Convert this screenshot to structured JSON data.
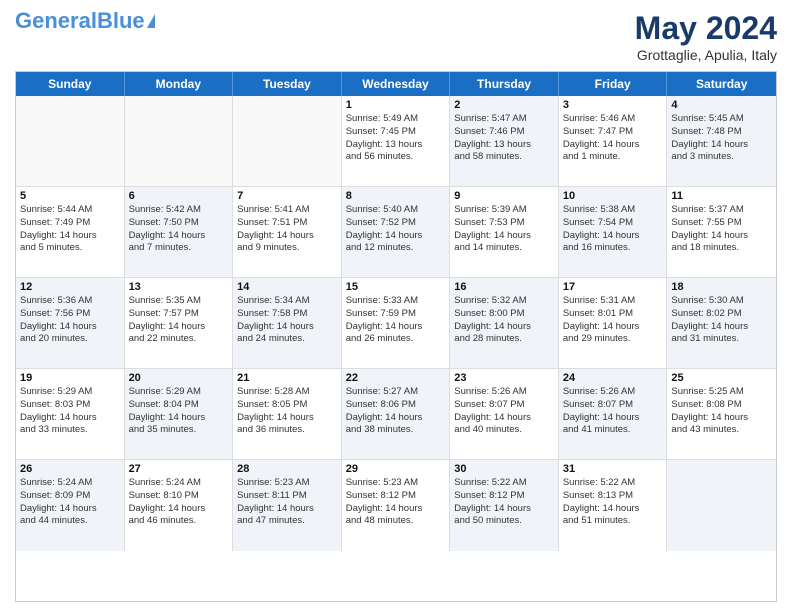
{
  "header": {
    "logo_general": "General",
    "logo_blue": "Blue",
    "month_title": "May 2024",
    "location": "Grottaglie, Apulia, Italy"
  },
  "weekdays": [
    "Sunday",
    "Monday",
    "Tuesday",
    "Wednesday",
    "Thursday",
    "Friday",
    "Saturday"
  ],
  "rows": [
    [
      {
        "day": "",
        "lines": [],
        "shaded": false
      },
      {
        "day": "",
        "lines": [],
        "shaded": false
      },
      {
        "day": "",
        "lines": [],
        "shaded": false
      },
      {
        "day": "1",
        "lines": [
          "Sunrise: 5:49 AM",
          "Sunset: 7:45 PM",
          "Daylight: 13 hours",
          "and 56 minutes."
        ],
        "shaded": false
      },
      {
        "day": "2",
        "lines": [
          "Sunrise: 5:47 AM",
          "Sunset: 7:46 PM",
          "Daylight: 13 hours",
          "and 58 minutes."
        ],
        "shaded": true
      },
      {
        "day": "3",
        "lines": [
          "Sunrise: 5:46 AM",
          "Sunset: 7:47 PM",
          "Daylight: 14 hours",
          "and 1 minute."
        ],
        "shaded": false
      },
      {
        "day": "4",
        "lines": [
          "Sunrise: 5:45 AM",
          "Sunset: 7:48 PM",
          "Daylight: 14 hours",
          "and 3 minutes."
        ],
        "shaded": true
      }
    ],
    [
      {
        "day": "5",
        "lines": [
          "Sunrise: 5:44 AM",
          "Sunset: 7:49 PM",
          "Daylight: 14 hours",
          "and 5 minutes."
        ],
        "shaded": false
      },
      {
        "day": "6",
        "lines": [
          "Sunrise: 5:42 AM",
          "Sunset: 7:50 PM",
          "Daylight: 14 hours",
          "and 7 minutes."
        ],
        "shaded": true
      },
      {
        "day": "7",
        "lines": [
          "Sunrise: 5:41 AM",
          "Sunset: 7:51 PM",
          "Daylight: 14 hours",
          "and 9 minutes."
        ],
        "shaded": false
      },
      {
        "day": "8",
        "lines": [
          "Sunrise: 5:40 AM",
          "Sunset: 7:52 PM",
          "Daylight: 14 hours",
          "and 12 minutes."
        ],
        "shaded": true
      },
      {
        "day": "9",
        "lines": [
          "Sunrise: 5:39 AM",
          "Sunset: 7:53 PM",
          "Daylight: 14 hours",
          "and 14 minutes."
        ],
        "shaded": false
      },
      {
        "day": "10",
        "lines": [
          "Sunrise: 5:38 AM",
          "Sunset: 7:54 PM",
          "Daylight: 14 hours",
          "and 16 minutes."
        ],
        "shaded": true
      },
      {
        "day": "11",
        "lines": [
          "Sunrise: 5:37 AM",
          "Sunset: 7:55 PM",
          "Daylight: 14 hours",
          "and 18 minutes."
        ],
        "shaded": false
      }
    ],
    [
      {
        "day": "12",
        "lines": [
          "Sunrise: 5:36 AM",
          "Sunset: 7:56 PM",
          "Daylight: 14 hours",
          "and 20 minutes."
        ],
        "shaded": true
      },
      {
        "day": "13",
        "lines": [
          "Sunrise: 5:35 AM",
          "Sunset: 7:57 PM",
          "Daylight: 14 hours",
          "and 22 minutes."
        ],
        "shaded": false
      },
      {
        "day": "14",
        "lines": [
          "Sunrise: 5:34 AM",
          "Sunset: 7:58 PM",
          "Daylight: 14 hours",
          "and 24 minutes."
        ],
        "shaded": true
      },
      {
        "day": "15",
        "lines": [
          "Sunrise: 5:33 AM",
          "Sunset: 7:59 PM",
          "Daylight: 14 hours",
          "and 26 minutes."
        ],
        "shaded": false
      },
      {
        "day": "16",
        "lines": [
          "Sunrise: 5:32 AM",
          "Sunset: 8:00 PM",
          "Daylight: 14 hours",
          "and 28 minutes."
        ],
        "shaded": true
      },
      {
        "day": "17",
        "lines": [
          "Sunrise: 5:31 AM",
          "Sunset: 8:01 PM",
          "Daylight: 14 hours",
          "and 29 minutes."
        ],
        "shaded": false
      },
      {
        "day": "18",
        "lines": [
          "Sunrise: 5:30 AM",
          "Sunset: 8:02 PM",
          "Daylight: 14 hours",
          "and 31 minutes."
        ],
        "shaded": true
      }
    ],
    [
      {
        "day": "19",
        "lines": [
          "Sunrise: 5:29 AM",
          "Sunset: 8:03 PM",
          "Daylight: 14 hours",
          "and 33 minutes."
        ],
        "shaded": false
      },
      {
        "day": "20",
        "lines": [
          "Sunrise: 5:29 AM",
          "Sunset: 8:04 PM",
          "Daylight: 14 hours",
          "and 35 minutes."
        ],
        "shaded": true
      },
      {
        "day": "21",
        "lines": [
          "Sunrise: 5:28 AM",
          "Sunset: 8:05 PM",
          "Daylight: 14 hours",
          "and 36 minutes."
        ],
        "shaded": false
      },
      {
        "day": "22",
        "lines": [
          "Sunrise: 5:27 AM",
          "Sunset: 8:06 PM",
          "Daylight: 14 hours",
          "and 38 minutes."
        ],
        "shaded": true
      },
      {
        "day": "23",
        "lines": [
          "Sunrise: 5:26 AM",
          "Sunset: 8:07 PM",
          "Daylight: 14 hours",
          "and 40 minutes."
        ],
        "shaded": false
      },
      {
        "day": "24",
        "lines": [
          "Sunrise: 5:26 AM",
          "Sunset: 8:07 PM",
          "Daylight: 14 hours",
          "and 41 minutes."
        ],
        "shaded": true
      },
      {
        "day": "25",
        "lines": [
          "Sunrise: 5:25 AM",
          "Sunset: 8:08 PM",
          "Daylight: 14 hours",
          "and 43 minutes."
        ],
        "shaded": false
      }
    ],
    [
      {
        "day": "26",
        "lines": [
          "Sunrise: 5:24 AM",
          "Sunset: 8:09 PM",
          "Daylight: 14 hours",
          "and 44 minutes."
        ],
        "shaded": true
      },
      {
        "day": "27",
        "lines": [
          "Sunrise: 5:24 AM",
          "Sunset: 8:10 PM",
          "Daylight: 14 hours",
          "and 46 minutes."
        ],
        "shaded": false
      },
      {
        "day": "28",
        "lines": [
          "Sunrise: 5:23 AM",
          "Sunset: 8:11 PM",
          "Daylight: 14 hours",
          "and 47 minutes."
        ],
        "shaded": true
      },
      {
        "day": "29",
        "lines": [
          "Sunrise: 5:23 AM",
          "Sunset: 8:12 PM",
          "Daylight: 14 hours",
          "and 48 minutes."
        ],
        "shaded": false
      },
      {
        "day": "30",
        "lines": [
          "Sunrise: 5:22 AM",
          "Sunset: 8:12 PM",
          "Daylight: 14 hours",
          "and 50 minutes."
        ],
        "shaded": true
      },
      {
        "day": "31",
        "lines": [
          "Sunrise: 5:22 AM",
          "Sunset: 8:13 PM",
          "Daylight: 14 hours",
          "and 51 minutes."
        ],
        "shaded": false
      },
      {
        "day": "",
        "lines": [],
        "shaded": true
      }
    ]
  ]
}
